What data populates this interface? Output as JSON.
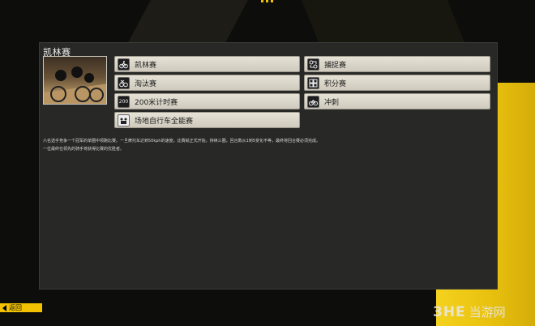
{
  "header": {
    "indicator": "•••"
  },
  "panel": {
    "title": "凯林赛",
    "thumbnail_alt": "场地自行车赛图片",
    "modes": [
      {
        "label": "凯林赛",
        "icon": "keirin-icon"
      },
      {
        "label": "捕捉赛",
        "icon": "pursuit-icon"
      },
      {
        "label": "淘汰赛",
        "icon": "elimination-icon"
      },
      {
        "label": "积分赛",
        "icon": "points-icon"
      },
      {
        "label": "200米计时赛",
        "icon": "timetrial-200-icon",
        "icon_text": "200"
      },
      {
        "label": "冲刺",
        "icon": "sprint-bike-icon"
      },
      {
        "label": "场地自行车全能赛",
        "icon": "omnium-icon"
      }
    ],
    "description": [
      "六名选手竞争一个冠军的单圈中领跑比赛。一旦摩托车达到50kph的速度，比赛就正式开始，持续三圈，回合数从1到5变化不等，最终将回合赛必须完成。",
      "一位最终在领先的骑手将获得比赛的优胜者。"
    ]
  },
  "footer": {
    "back_label": "返回"
  },
  "watermark": {
    "logo": "3HE",
    "site": "当游网"
  }
}
